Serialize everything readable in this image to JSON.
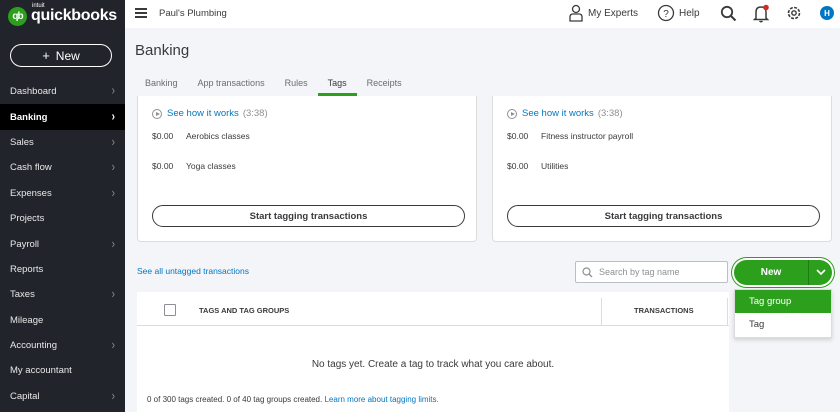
{
  "brand": {
    "intuit": "intuit",
    "name": "quickbooks",
    "mark": "qb"
  },
  "sidebar": {
    "new_label": "New",
    "items": [
      {
        "label": "Dashboard",
        "chevron": true
      },
      {
        "label": "Banking",
        "chevron": true,
        "active": true
      },
      {
        "label": "Sales",
        "chevron": true
      },
      {
        "label": "Cash flow",
        "chevron": true
      },
      {
        "label": "Expenses",
        "chevron": true
      },
      {
        "label": "Projects",
        "chevron": false
      },
      {
        "label": "Payroll",
        "chevron": true
      },
      {
        "label": "Reports",
        "chevron": false
      },
      {
        "label": "Taxes",
        "chevron": true
      },
      {
        "label": "Mileage",
        "chevron": false
      },
      {
        "label": "Accounting",
        "chevron": true
      },
      {
        "label": "My accountant",
        "chevron": false
      },
      {
        "label": "Capital",
        "chevron": true
      }
    ]
  },
  "header": {
    "company": "Paul's Plumbing",
    "my_experts": "My Experts",
    "help": "Help",
    "avatar_initial": "H"
  },
  "page": {
    "title": "Banking",
    "tabs": [
      {
        "label": "Banking"
      },
      {
        "label": "App transactions"
      },
      {
        "label": "Rules"
      },
      {
        "label": "Tags",
        "active": true
      },
      {
        "label": "Receipts"
      }
    ]
  },
  "cards": [
    {
      "see_how": "See how it works",
      "duration": "(3:38)",
      "rows": [
        {
          "amount": "$0.00",
          "name": "Aerobics classes"
        },
        {
          "amount": "$0.00",
          "name": "Yoga classes"
        }
      ],
      "button": "Start tagging transactions"
    },
    {
      "see_how": "See how it works",
      "duration": "(3:38)",
      "rows": [
        {
          "amount": "$0.00",
          "name": "Fitness instructor payroll"
        },
        {
          "amount": "$0.00",
          "name": "Utilities"
        }
      ],
      "button": "Start tagging transactions"
    }
  ],
  "tags_section": {
    "untagged_link": "See all untagged transactions",
    "search_placeholder": "Search by tag name",
    "new_button": "New",
    "dropdown": [
      "Tag group",
      "Tag"
    ],
    "col_tags": "TAGS AND TAG GROUPS",
    "col_transactions": "TRANSACTIONS",
    "empty_message": "No tags yet. Create a tag to track what you care about.",
    "limits_text": "0 of 300 tags created. 0 of 40 tag groups created.",
    "limits_link": "Learn more about tagging limits."
  },
  "colors": {
    "accent": "#2ca01c",
    "link": "#0077c5",
    "sidebar": "#21242b"
  }
}
